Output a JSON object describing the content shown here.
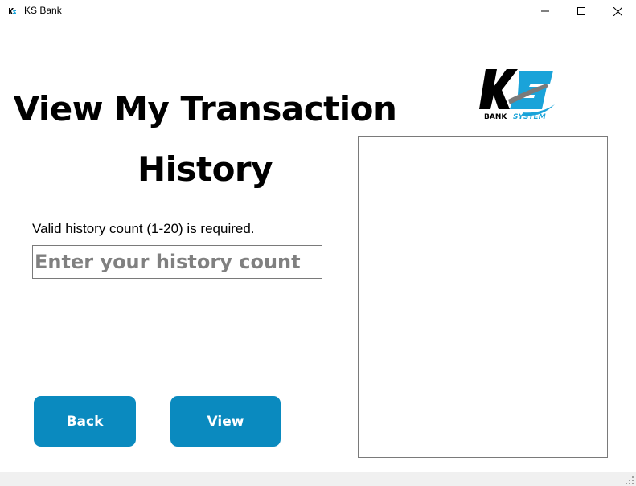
{
  "window": {
    "title": "KS Bank",
    "controls": [
      "minimize",
      "maximize",
      "close"
    ]
  },
  "page": {
    "heading": "View My Transaction History",
    "validation_message": "Valid history count (1-20) is required.",
    "history_input": {
      "value": "",
      "placeholder": "Enter your history count"
    },
    "buttons": {
      "back_label": "Back",
      "view_label": "View"
    }
  },
  "logo": {
    "main_text": "KS",
    "sub_text_left": "BANK",
    "sub_text_right": "SYSTEM"
  },
  "colors": {
    "button_bg": "#0a8abf",
    "button_text": "#ffffff",
    "logo_dark": "#000000",
    "logo_accent": "#1aa3d9"
  }
}
